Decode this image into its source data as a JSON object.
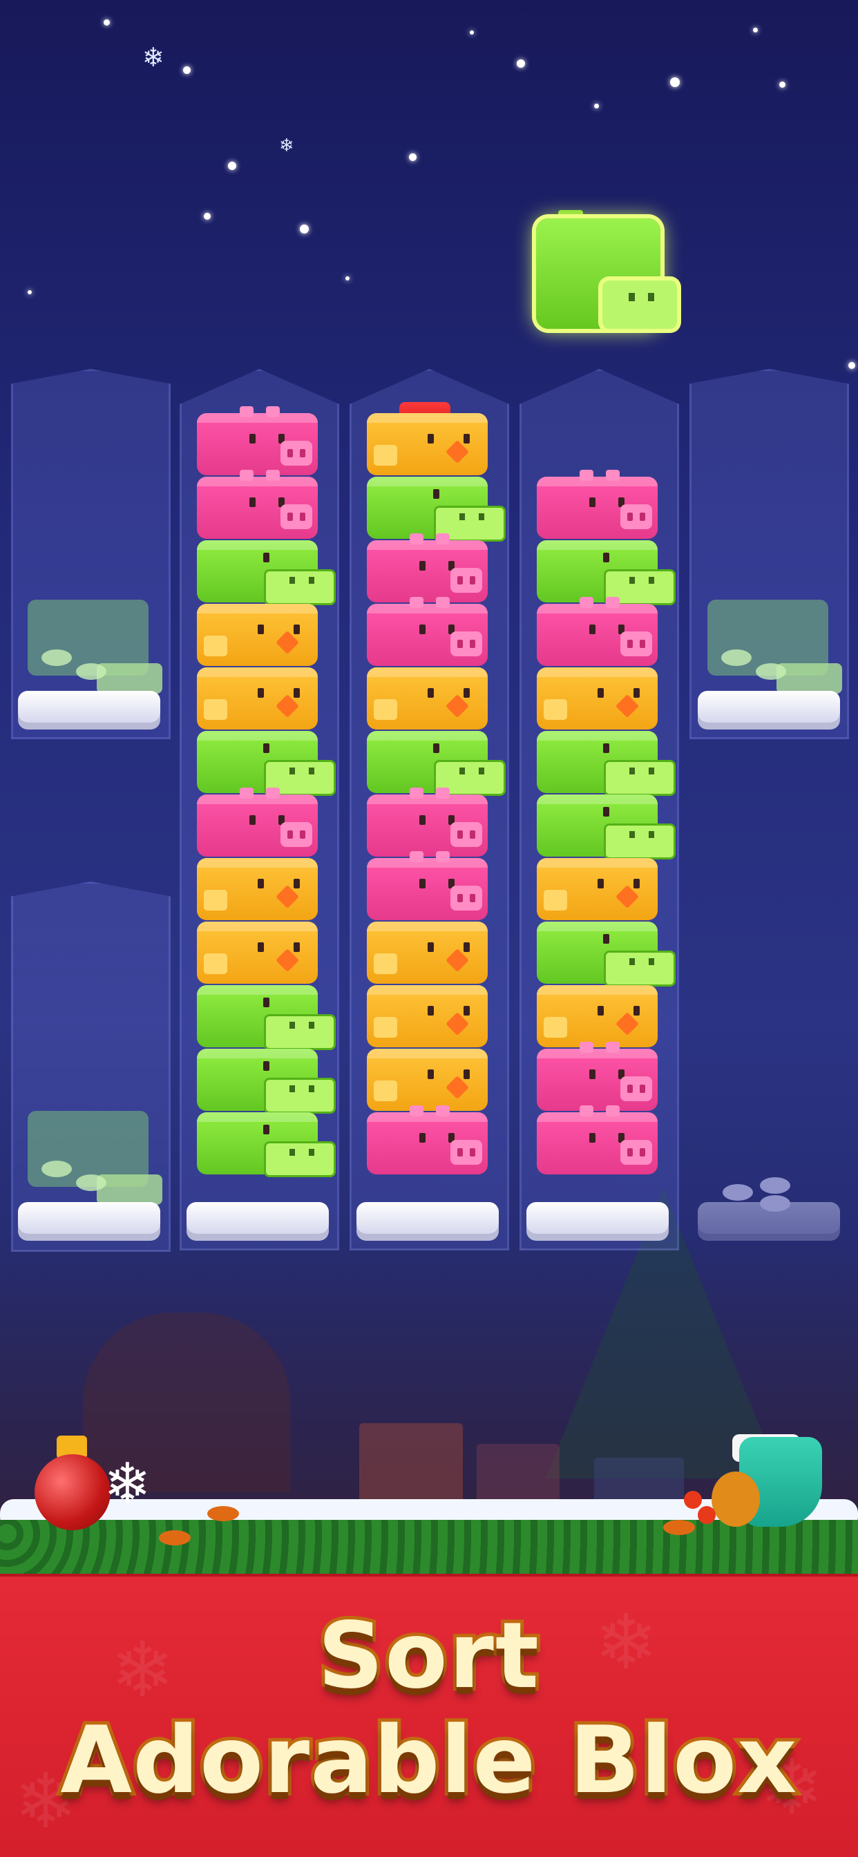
{
  "promo": {
    "headline_line1": "Sort",
    "headline_line2": "Adorable Blox"
  },
  "game": {
    "held_block": "croc",
    "columns": [
      {
        "id": "col-1-top",
        "blocks": [],
        "state": "empty-ghost-croc"
      },
      {
        "id": "col-2",
        "blocks": [
          "croc",
          "croc",
          "croc",
          "chick",
          "chick",
          "pig",
          "croc",
          "chick",
          "chick",
          "croc",
          "pig",
          "pig"
        ]
      },
      {
        "id": "col-3",
        "blocks": [
          "pig",
          "chick",
          "chick",
          "chick",
          "pig",
          "pig",
          "croc",
          "chick",
          "pig",
          "pig",
          "croc",
          "chick"
        ],
        "top_accessory": "chick-comb"
      },
      {
        "id": "col-4",
        "blocks": [
          "pig",
          "pig",
          "chick",
          "croc",
          "chick",
          "croc",
          "croc",
          "chick",
          "pig",
          "croc",
          "pig"
        ]
      },
      {
        "id": "col-5-top",
        "blocks": [],
        "state": "empty-ghost-croc"
      },
      {
        "id": "col-1-bottom",
        "blocks": [],
        "state": "empty-ghost-croc"
      },
      {
        "id": "col-5-bottom",
        "blocks": [],
        "state": "locked-grey"
      }
    ]
  },
  "colors": {
    "pig": "#ff55a8",
    "croc": "#84e236",
    "chick": "#ffbd2e",
    "banner": "#dc2432",
    "sky": "#1f2470"
  }
}
